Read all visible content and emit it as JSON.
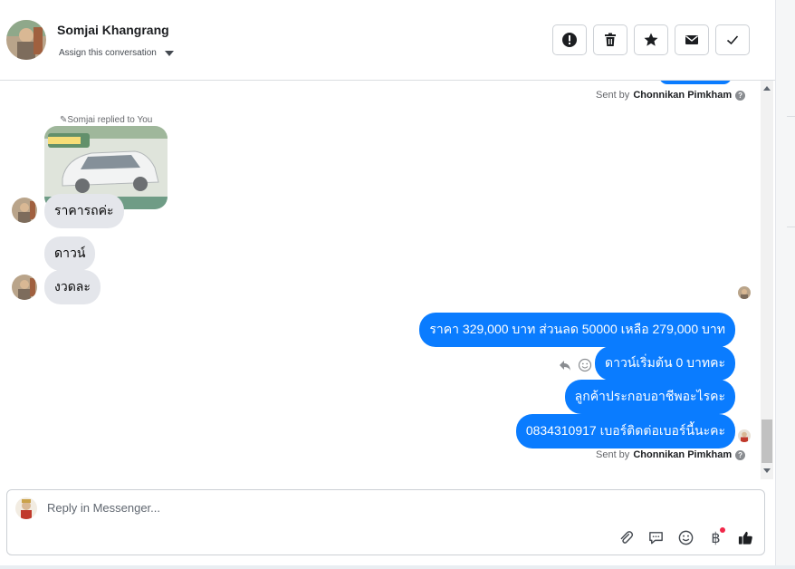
{
  "header": {
    "contact_name": "Somjai Khangrang",
    "assign_label": "Assign this conversation",
    "actions": [
      "spam-icon",
      "trash-icon",
      "star-icon",
      "mail-icon",
      "check-icon"
    ]
  },
  "chat": {
    "sent_by_prefix": "Sent by",
    "sent_by_name": "Chonnikan Pimkham",
    "reply_note": "Somjai replied to You",
    "incoming": [
      {
        "text": "ราคารถค่ะ"
      },
      {
        "text": "ดาวน์"
      },
      {
        "text": "งวดละ"
      }
    ],
    "outgoing": [
      {
        "text": "ราคา 329,000 บาท ส่วนลด 50000 เหลือ 279,000 บาท"
      },
      {
        "text": "ดาวน์เริ่มต้น 0 บาทคะ"
      },
      {
        "text": "ลูกค้าประกอบอาชีพอะไรคะ"
      },
      {
        "text": "0834310917 เบอร์ติดต่อเบอร์นี้นะคะ"
      }
    ]
  },
  "composer": {
    "placeholder": "Reply in Messenger...",
    "tools": [
      "paperclip-icon",
      "chat-bubble-icon",
      "emoji-icon",
      "baht-icon",
      "thumbs-up-icon"
    ],
    "baht_symbol": "฿"
  },
  "colors": {
    "accent": "#0a7cff",
    "incoming_bubble": "#e4e6eb",
    "border": "#ccd0d5"
  }
}
